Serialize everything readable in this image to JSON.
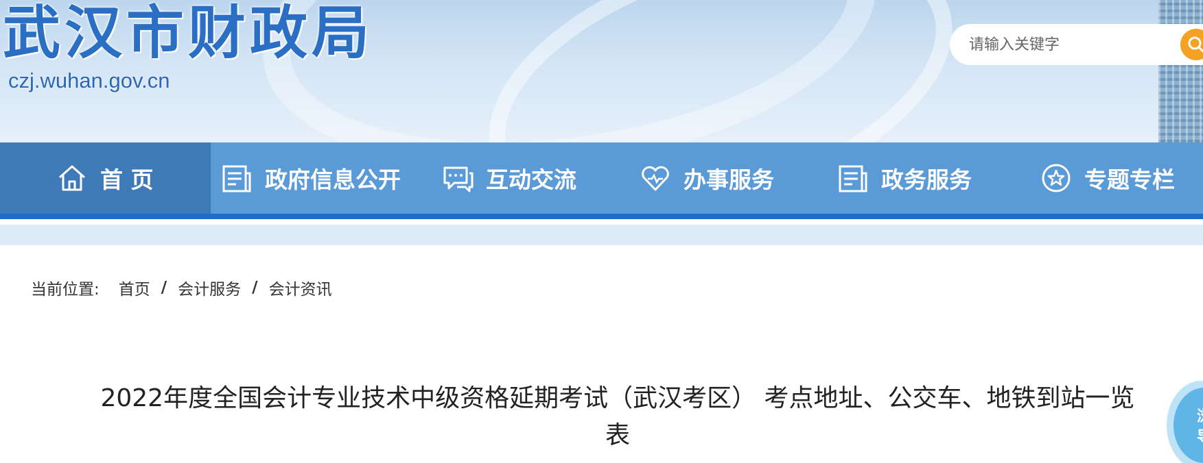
{
  "site": {
    "title": "武汉市财政局",
    "domain": "czj.wuhan.gov.cn"
  },
  "search": {
    "placeholder": "请输入关键字",
    "icon": "search-icon"
  },
  "nav": {
    "items": [
      {
        "label": "首 页",
        "icon": "home-icon",
        "active": true
      },
      {
        "label": "政府信息公开",
        "icon": "document-icon"
      },
      {
        "label": "互动交流",
        "icon": "chat-icon"
      },
      {
        "label": "办事服务",
        "icon": "heart-icon"
      },
      {
        "label": "政务服务",
        "icon": "document-icon"
      },
      {
        "label": "专题专栏",
        "icon": "star-icon"
      }
    ]
  },
  "breadcrumb": {
    "prefix": "当前位置:",
    "items": [
      "首页",
      "会计服务",
      "会计资讯"
    ],
    "separator": "/"
  },
  "article": {
    "title": "2022年度全国会计专业技术中级资格延期考试（武汉考区） 考点地址、公交车、地铁到站一览表"
  },
  "float_badge": {
    "line1": "浏",
    "line2": "导"
  },
  "colors": {
    "nav_bg": "#5a9ad6",
    "nav_active": "#3f7ab8",
    "nav_border": "#1d6cc8",
    "brand_text": "#2b6fc4",
    "search_button": "#f5a123"
  }
}
